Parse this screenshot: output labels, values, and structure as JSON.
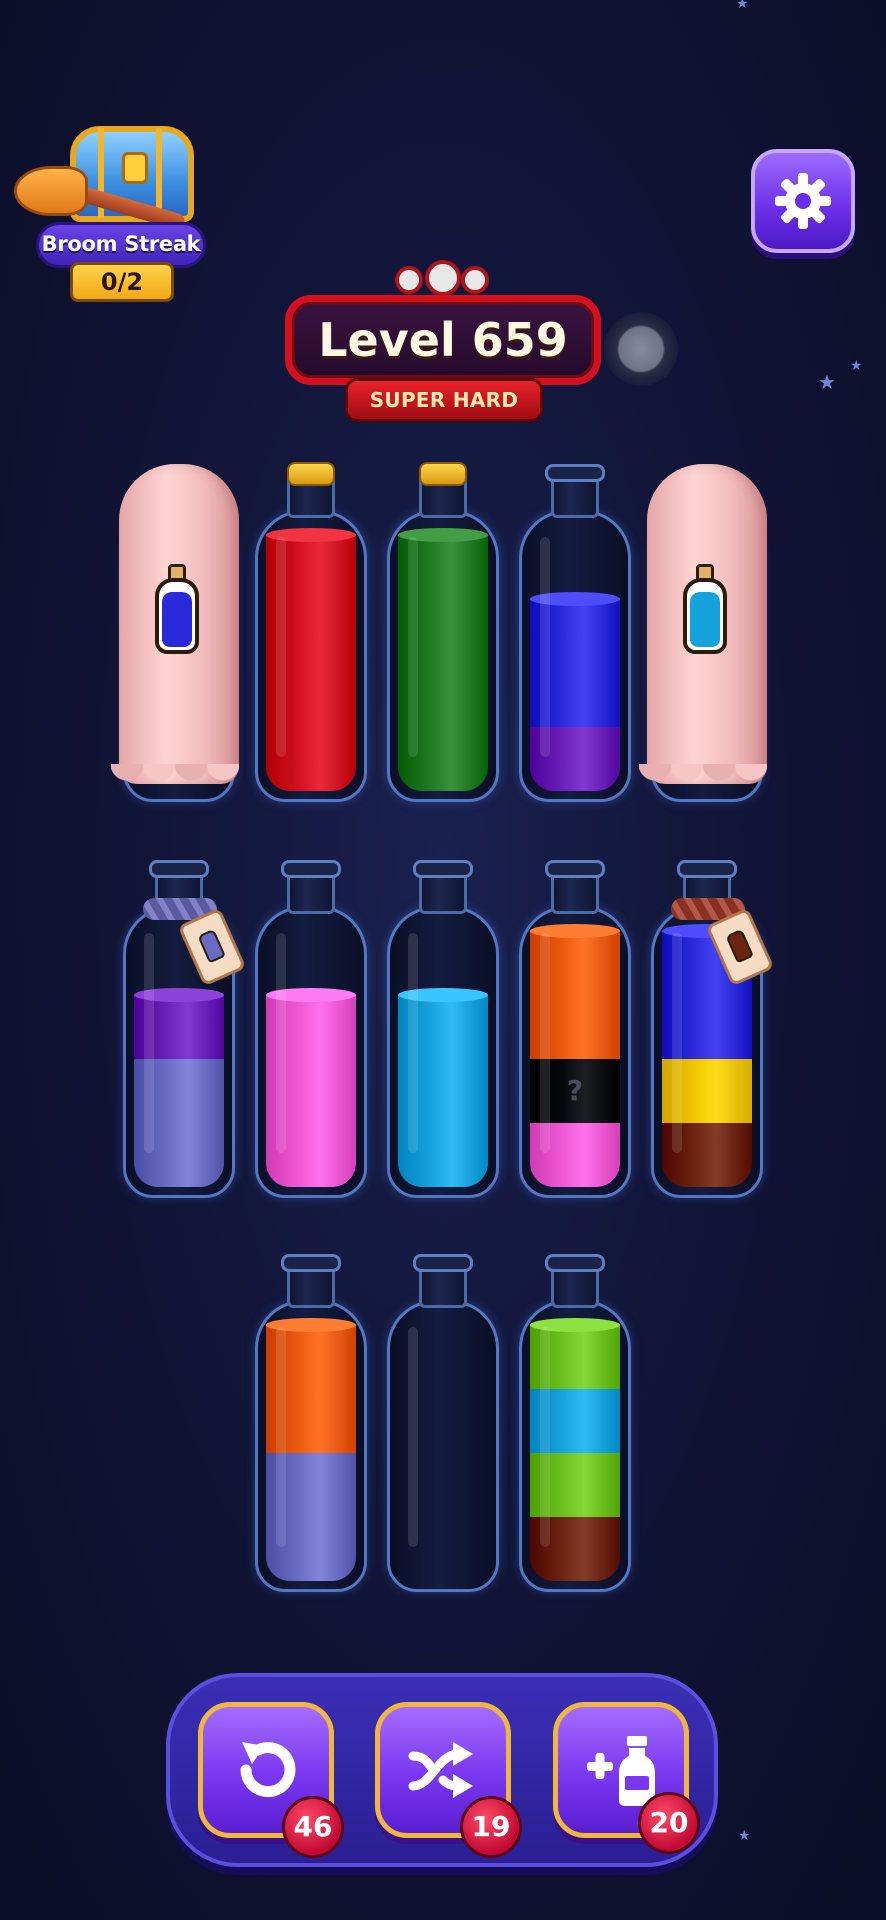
{
  "streak": {
    "title": "Broom Streak",
    "count": "0/2",
    "icon": "treasure-chest-with-broom"
  },
  "settings": {
    "icon": "gear-icon"
  },
  "level": {
    "title": "Level 659",
    "difficulty": "SUPER HARD",
    "difficulty_icon": "skull-icon"
  },
  "colors": {
    "red": "#d01020",
    "green": "#1f7a22",
    "blue": "#2a2adb",
    "purple": "#6a20b8",
    "lavender": "#6a6cc4",
    "pink": "#ee58d2",
    "cyan": "#16a2dc",
    "orange": "#ea5a10",
    "yellow": "#f0c400",
    "brown": "#6b2410",
    "lime": "#6abf1e",
    "hidden": "#05060c"
  },
  "bottles": [
    {
      "row": 1,
      "state": "covered",
      "hint_color": "blue"
    },
    {
      "row": 1,
      "state": "corked",
      "layers": [
        {
          "color": "red",
          "units": 4
        }
      ]
    },
    {
      "row": 1,
      "state": "corked",
      "layers": [
        {
          "color": "green",
          "units": 4
        }
      ]
    },
    {
      "row": 1,
      "state": "open",
      "layers": [
        {
          "color": "purple",
          "units": 1
        },
        {
          "color": "blue",
          "units": 2
        }
      ]
    },
    {
      "row": 1,
      "state": "covered",
      "hint_color": "cyan"
    },
    {
      "row": 2,
      "state": "tied",
      "rope_color": "#5b5aa0",
      "tag_color": "lavender",
      "layers": [
        {
          "color": "lavender",
          "units": 2
        },
        {
          "color": "purple",
          "units": 1
        }
      ]
    },
    {
      "row": 2,
      "state": "open",
      "layers": [
        {
          "color": "pink",
          "units": 3
        }
      ]
    },
    {
      "row": 2,
      "state": "open",
      "layers": [
        {
          "color": "cyan",
          "units": 3
        }
      ]
    },
    {
      "row": 2,
      "state": "open",
      "layers": [
        {
          "color": "pink",
          "units": 1
        },
        {
          "color": "hidden",
          "units": 1,
          "label": "?"
        },
        {
          "color": "orange",
          "units": 2
        }
      ]
    },
    {
      "row": 2,
      "state": "tied",
      "rope_color": "#8a3020",
      "tag_color": "brown",
      "layers": [
        {
          "color": "brown",
          "units": 1
        },
        {
          "color": "yellow",
          "units": 1
        },
        {
          "color": "blue",
          "units": 2
        }
      ]
    },
    {
      "row": 3,
      "state": "open",
      "layers": [
        {
          "color": "lavender",
          "units": 2
        },
        {
          "color": "orange",
          "units": 2
        }
      ]
    },
    {
      "row": 3,
      "state": "open",
      "layers": []
    },
    {
      "row": 3,
      "state": "open",
      "layers": [
        {
          "color": "brown",
          "units": 1
        },
        {
          "color": "lime",
          "units": 1
        },
        {
          "color": "cyan",
          "units": 1
        },
        {
          "color": "lime",
          "units": 1
        }
      ]
    }
  ],
  "powerups": [
    {
      "name": "undo",
      "icon": "undo-icon",
      "count": "46"
    },
    {
      "name": "shuffle",
      "icon": "shuffle-icon",
      "count": "19"
    },
    {
      "name": "add-bottle",
      "icon": "add-bottle-icon",
      "count": "20"
    }
  ]
}
